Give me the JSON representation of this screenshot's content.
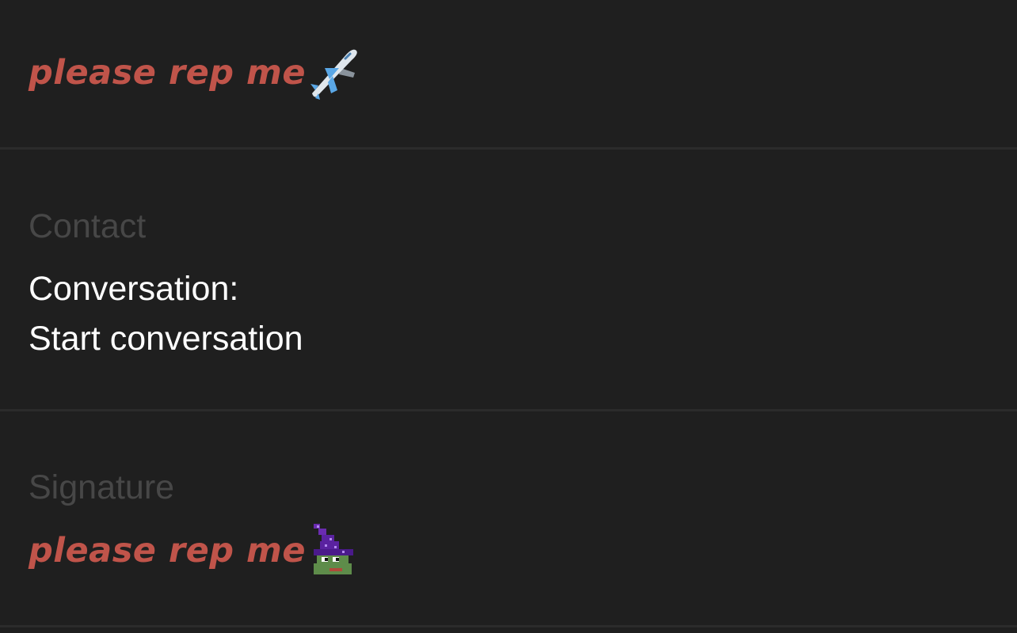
{
  "header": {
    "name_text": "please rep me",
    "name_emoji": "airplane-emoji",
    "name_color": "#c0544a"
  },
  "contact": {
    "label": "Contact",
    "conversation_label": "Conversation:",
    "conversation_action": "Start conversation"
  },
  "signature": {
    "label": "Signature",
    "text": "please rep me",
    "emoji": "pixel-wizard-frog-emoji"
  },
  "colors": {
    "background": "#1f1f1f",
    "divider": "#2b2b2b",
    "label": "#474747",
    "value": "#ffffff"
  }
}
